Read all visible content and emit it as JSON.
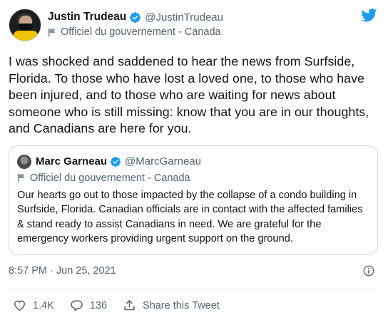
{
  "tweet": {
    "author": {
      "name": "Justin Trudeau",
      "handle": "@JustinTrudeau",
      "label": "Officiel du gouvernement - Canada"
    },
    "text": "I was shocked and saddened to hear the news from Surfside, Florida. To those who have lost a loved one, to those who have been injured, and to those who are waiting for news about someone who is still missing: know that you are in our thoughts, and Canadians are here for you.",
    "timestamp": "8:57 PM · Jun 25, 2021",
    "likes": "1.4K",
    "replies": "136",
    "share_label": "Share this Tweet"
  },
  "quoted_tweet": {
    "author": {
      "name": "Marc Garneau",
      "handle": "@MarcGarneau",
      "label": "Officiel du gouvernement - Canada"
    },
    "text": "Our hearts go out to those impacted by the collapse of a condo building in Surfside, Florida. Canadian officials are in contact with the affected families & stand ready to assist Canadians in need. We are grateful for the emergency workers providing urgent support on the ground."
  },
  "icons": {
    "verified": "verified-badge-icon",
    "flag": "government-flag-icon",
    "twitter": "twitter-bird-icon",
    "info": "info-icon",
    "like": "heart-icon",
    "reply": "reply-bubble-icon",
    "share": "share-icon"
  },
  "colors": {
    "twitter_blue": "#1d9bf0",
    "text_primary": "#0f1419",
    "text_secondary": "#536471",
    "border": "#cfd9de"
  }
}
